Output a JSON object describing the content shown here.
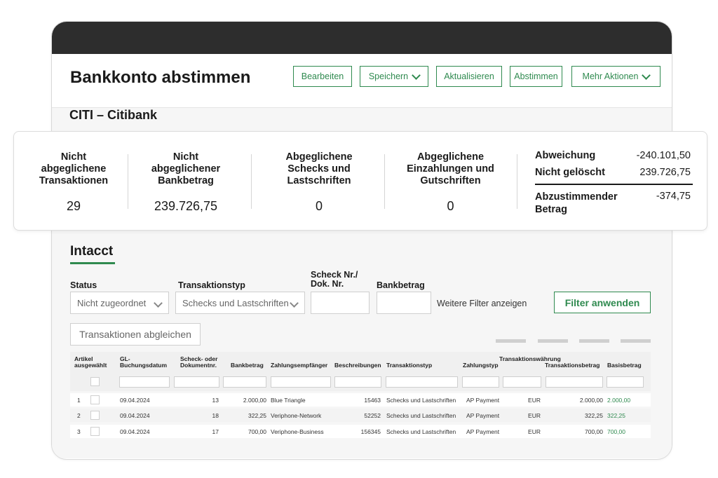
{
  "header": {
    "title": "Bankkonto abstimmen",
    "buttons": {
      "edit": "Bearbeiten",
      "save": "Speichern",
      "refresh": "Aktualisieren",
      "reconcile": "Abstimmen",
      "more": "Mehr Aktionen"
    }
  },
  "account": {
    "name": "CITI – Citibank"
  },
  "summary": {
    "metrics": [
      {
        "label": "Nicht abgeglichene Transaktionen",
        "value": "29"
      },
      {
        "label": "Nicht abgeglichener Bankbetrag",
        "value": "239.726,75"
      },
      {
        "label": "Abgeglichene Schecks und Lastschriften",
        "value": "0"
      },
      {
        "label": "Abgeglichene Einzahlungen und Gutschriften",
        "value": "0"
      }
    ],
    "balances": {
      "deviation_label": "Abweichung",
      "deviation_value": "-240.101,50",
      "uncleared_label": "Nicht gelöscht",
      "uncleared_value": "239.726,75",
      "to_reconcile_label": "Abzustimmender Betrag",
      "to_reconcile_value": "-374,75"
    }
  },
  "section": {
    "title": "Intacct"
  },
  "filters": {
    "status_label": "Status",
    "status_value": "Nicht zugeordnet",
    "type_label": "Transaktionstyp",
    "type_value": "Schecks und Lastschriften",
    "check_label": "Scheck Nr./ Dok. Nr.",
    "amount_label": "Bankbetrag",
    "more_filters": "Weitere Filter anzeigen",
    "apply": "Filter anwenden"
  },
  "match_button": "Transaktionen abgleichen",
  "table": {
    "columns": {
      "selected": "Artikel ausgewählt",
      "posting_date": "GL-Buchungsdatum",
      "doc_no": "Scheck- oder Dokumentnr.",
      "bank_amount": "Bankbetrag",
      "payee": "Zahlungsempfänger",
      "descriptions": "Beschreibungen",
      "txn_type": "Transaktionstyp",
      "pay_type": "Zahlungstyp",
      "currency": "Transaktionswährung",
      "txn_amount": "Transaktionsbetrag",
      "base_amount": "Basisbetrag"
    },
    "rows": [
      {
        "n": "1",
        "date": "09.04.2024",
        "doc": "13",
        "amount": "2.000,00",
        "payee": "Blue Triangle",
        "desc": "15463",
        "type": "Schecks und Lastschriften",
        "paytype": "AP Payment",
        "cur": "EUR",
        "txn": "2.000,00",
        "base": "2.000,00"
      },
      {
        "n": "2",
        "date": "09.04.2024",
        "doc": "18",
        "amount": "322,25",
        "payee": "Veriphone-Network",
        "desc": "52252",
        "type": "Schecks und Lastschriften",
        "paytype": "AP Payment",
        "cur": "EUR",
        "txn": "322,25",
        "base": "322,25"
      },
      {
        "n": "3",
        "date": "09.04.2024",
        "doc": "17",
        "amount": "700,00",
        "payee": "Veriphone-Business",
        "desc": "156345",
        "type": "Schecks und Lastschriften",
        "paytype": "AP Payment",
        "cur": "EUR",
        "txn": "700,00",
        "base": "700,00"
      }
    ]
  }
}
